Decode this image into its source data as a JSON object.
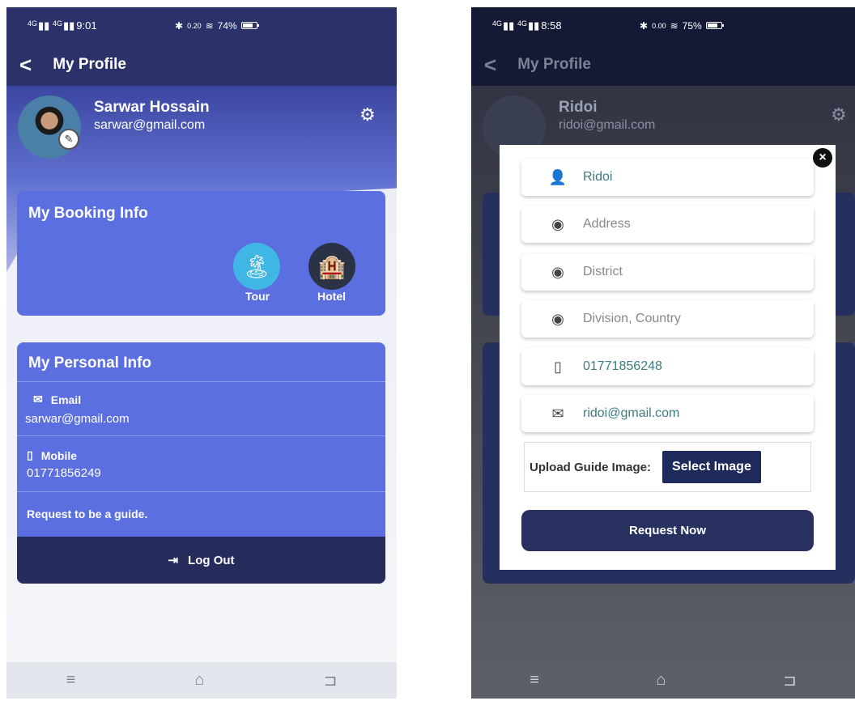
{
  "left": {
    "status": {
      "sig1": "4G",
      "sig2": "4G",
      "time": "9:01",
      "speed": "0.20",
      "battery": "74%"
    },
    "header": {
      "title": "My Profile"
    },
    "profile": {
      "name": "Sarwar Hossain",
      "email": "sarwar@gmail.com"
    },
    "booking": {
      "title": "My Booking Info",
      "tour_label": "Tour",
      "hotel_label": "Hotel"
    },
    "personal": {
      "title": "My Personal Info",
      "email_label": "Email",
      "email_value": "sarwar@gmail.com",
      "mobile_label": "Mobile",
      "mobile_value": "01771856249",
      "guide_link": "Request to be a guide.",
      "logout_label": "Log Out"
    }
  },
  "right": {
    "status": {
      "sig1": "4G",
      "sig2": "4G",
      "time": "8:58",
      "speed": "0.00",
      "battery": "75%"
    },
    "header": {
      "title": "My Profile"
    },
    "profile": {
      "name": "Ridoi",
      "email": "ridoi@gmail.com"
    },
    "modal": {
      "name_value": "Ridoi",
      "address_placeholder": "Address",
      "district_placeholder": "District",
      "division_placeholder": "Division, Country",
      "phone_value": "01771856248",
      "email_value": "ridoi@gmail.com",
      "upload_label": "Upload Guide Image:",
      "select_button": "Select Image",
      "request_button": "Request Now"
    }
  },
  "colors": {
    "primary": "#5b6fe0",
    "dark": "#262b5c",
    "nav": "#2b3269"
  },
  "icons": [
    "back-icon",
    "gear-icon",
    "edit-icon",
    "email-icon",
    "phone-icon",
    "logout-icon",
    "person-icon",
    "location-icon",
    "close-icon",
    "menu-icon",
    "home-icon",
    "return-icon"
  ]
}
